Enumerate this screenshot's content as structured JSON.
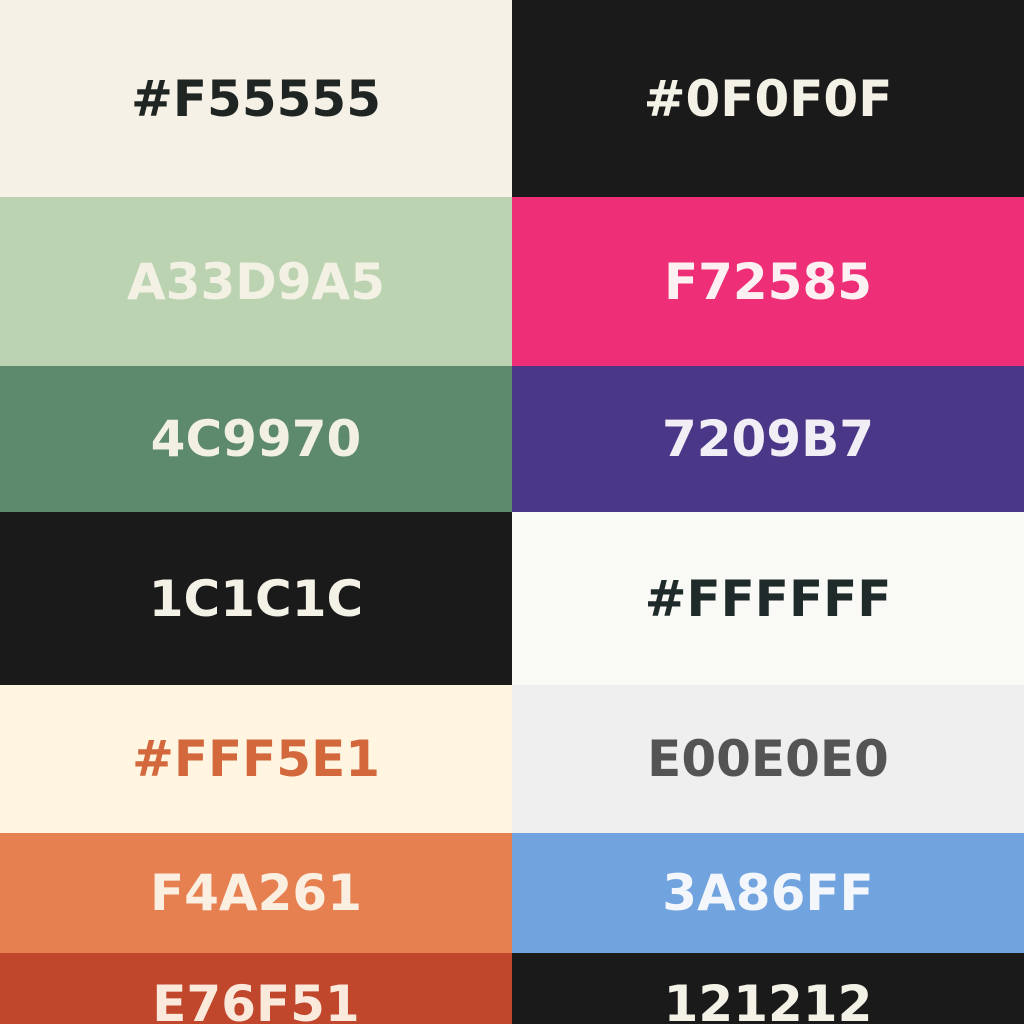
{
  "swatches_left": [
    {
      "label": "#F55555",
      "bg": "#f5f1e6",
      "fg": "#1e2522"
    },
    {
      "label": "A33D9A5",
      "bg": "#bcd3b2",
      "fg": "#f3f1e4"
    },
    {
      "label": "4C9970",
      "bg": "#5d8a6a",
      "fg": "#f2f0e2"
    },
    {
      "label": "1C1C1C",
      "bg": "#1a1a1a",
      "fg": "#f4f1e6"
    },
    {
      "label": "#FFF5E1",
      "bg": "#fff5e1",
      "fg": "#d2683c"
    },
    {
      "label": "F4A261",
      "bg": "#e68050",
      "fg": "#fbefe1"
    },
    {
      "label": "E76F51",
      "bg": "#c0462c",
      "fg": "#fbe9dc"
    }
  ],
  "swatches_right": [
    {
      "label": "#0F0F0F",
      "bg": "#1a1a1a",
      "fg": "#f4f1e6"
    },
    {
      "label": "F72585",
      "bg": "#ee2e76",
      "fg": "#fdf0f3"
    },
    {
      "label": "7209B7",
      "bg": "#4a3788",
      "fg": "#f1eef5"
    },
    {
      "label": "#FFFFFF",
      "bg": "#f9f9f5",
      "fg": "#1f2a2a"
    },
    {
      "label": "E00E0E0",
      "bg": "#efefef",
      "fg": "#545454"
    },
    {
      "label": "3A86FF",
      "bg": "#71a3df",
      "fg": "#f3f6fb"
    },
    {
      "label": "121212",
      "bg": "#1a1a1a",
      "fg": "#f4f1e6"
    }
  ]
}
